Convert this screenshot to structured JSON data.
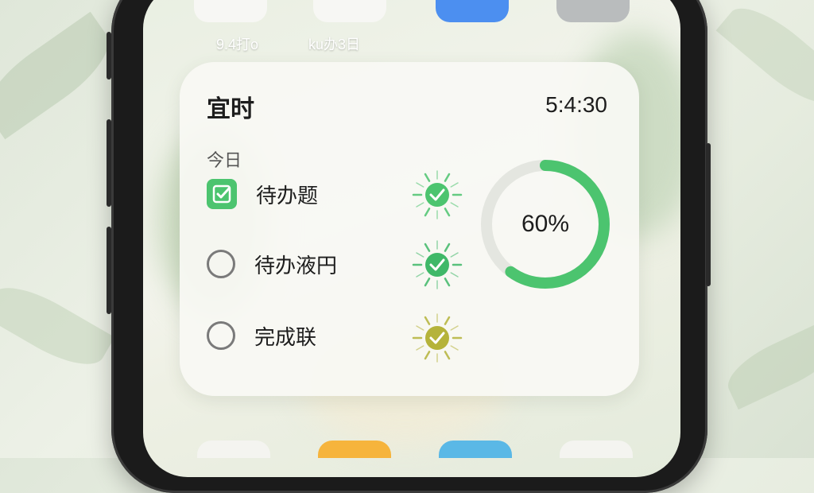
{
  "top_apps": {
    "labels": [
      "9.4打o",
      "ku办3日"
    ]
  },
  "widget": {
    "title": "宜时",
    "time": "5:4:30",
    "section_label": "今日",
    "progress_percent": 60,
    "progress_label": "60%",
    "tasks": [
      {
        "label": "待办题",
        "checked": true,
        "status_color": "#4cc46f"
      },
      {
        "label": "待办液円",
        "checked": false,
        "status_color": "#3fb868"
      },
      {
        "label": "完成联",
        "checked": false,
        "status_color": "#b5b33a"
      }
    ]
  },
  "colors": {
    "accent_green": "#4cc46f",
    "ring_track": "#e4e6e0",
    "olive": "#b5b33a"
  }
}
